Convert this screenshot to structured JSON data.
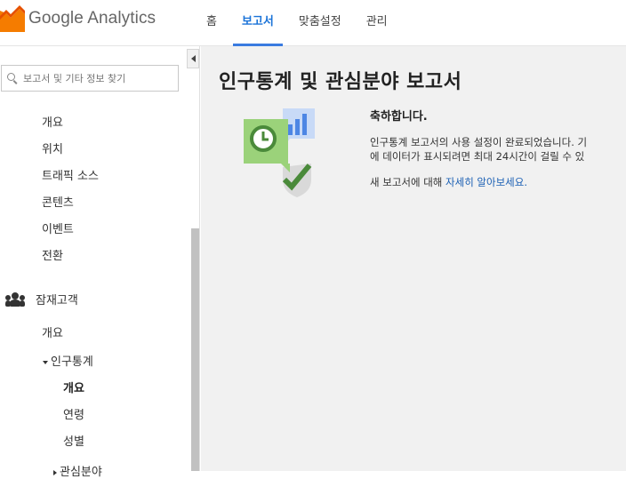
{
  "app": {
    "logo_google": "Google",
    "logo_analytics": "Analytics"
  },
  "nav": {
    "items": [
      {
        "label": "홈",
        "active": false
      },
      {
        "label": "보고서",
        "active": true
      },
      {
        "label": "맞춤설정",
        "active": false
      },
      {
        "label": "관리",
        "active": false
      }
    ]
  },
  "sidebar": {
    "search_placeholder": "보고서 및 기타 정보 찾기",
    "items_top": [
      "개요",
      "위치",
      "트래픽 소스",
      "콘텐츠",
      "이벤트",
      "전환"
    ],
    "section": "잠재고객",
    "section_overview": "개요",
    "sub_group": "인구통계",
    "sub_items": [
      "개요",
      "연령",
      "성별"
    ],
    "next_group": "관심분야"
  },
  "main": {
    "title": "인구통계 및 관심분야 보고서",
    "congrats": "축하합니다.",
    "message_line1": "인구통계 보고서의 사용 설정이 완료되었습니다. 기",
    "message_line2": "에 데이터가 표시되려면 최대 24시간이 걸릴 수 있",
    "more_prefix": "새 보고서에 대해 ",
    "more_link": "자세히 알아보세요."
  },
  "colors": {
    "accent": "#3a7be0",
    "logo_orange": "#f57c00",
    "illus_green": "#9bd27a",
    "illus_dark_green": "#4a8a3a",
    "illus_blue": "#4d86e4"
  }
}
